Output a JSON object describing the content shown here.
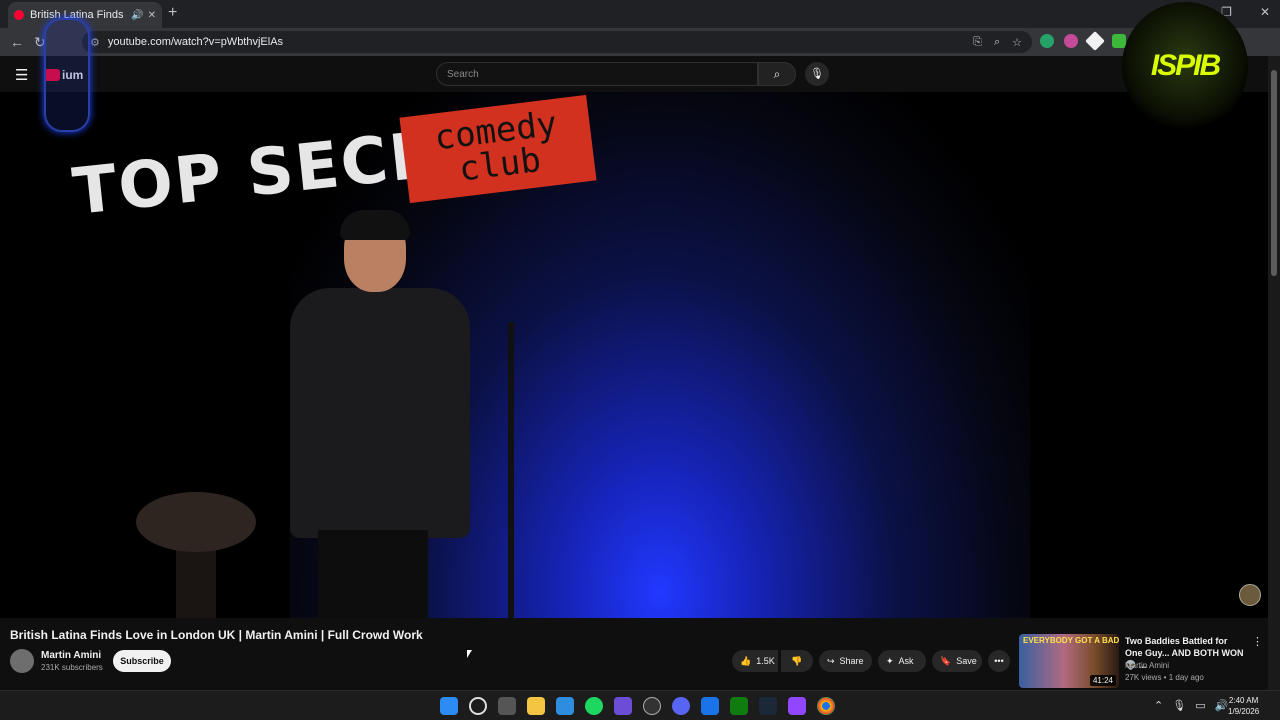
{
  "browser": {
    "tab_title": "British Latina Finds Love in London",
    "url": "youtube.com/watch?v=pWbthvjElAs"
  },
  "youtube": {
    "logo_text": "ium",
    "search_placeholder": "Search"
  },
  "overlay": {
    "right_text": "ISPIB"
  },
  "video": {
    "sign_left": "TOP SECRET",
    "sign_right": "comedy club",
    "title": "British Latina Finds Love in London UK | Martin Amini | Full Crowd Work"
  },
  "channel": {
    "name": "Martin Amini",
    "subscribers": "231K subscribers",
    "subscribe_label": "Subscribe"
  },
  "actions": {
    "likes": "1.5K",
    "share_label": "Share",
    "ask_label": "Ask",
    "save_label": "Save"
  },
  "recommendation": {
    "thumbnail_caption": "EVERYBODY GOT A BADDIE",
    "duration": "41:24",
    "title": "Two Baddies Battled for One Guy... AND BOTH WON 👽 ...",
    "channel": "Martin Amini",
    "meta": "27K views • 1 day ago"
  },
  "system": {
    "time": "2:40 AM",
    "date": "1/9/2026"
  },
  "colors": {
    "youtube_red": "#ff0033",
    "stage_blue": "#2138ff",
    "sign_red": "#d3311f",
    "overlay_yellow": "#d9ff00"
  }
}
